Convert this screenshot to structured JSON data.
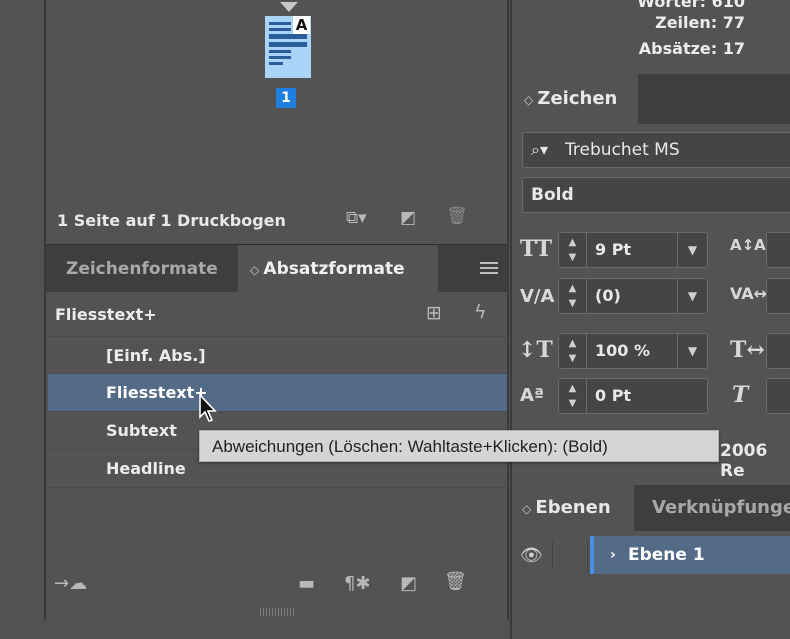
{
  "pages_panel": {
    "page_number": "1",
    "thumb_master": "A",
    "status": "1 Seite auf 1 Druckbogen"
  },
  "styles_panel": {
    "tabs": [
      "Zeichenformate",
      "Absatzformate"
    ],
    "active_tab_index": 1,
    "current_style": "Fliesstext+",
    "items": [
      "[Einf. Abs.]",
      "Fliesstext+",
      "Subtext",
      "Headline"
    ],
    "selected_index": 1,
    "tooltip": "Abweichungen (Löschen: Wahltaste+Klicken):  (Bold)"
  },
  "info_panel": {
    "words": "Wörter: 610",
    "lines": "Zeilen: 77",
    "paragraphs": "Absätze: 17"
  },
  "character_panel": {
    "tab_label": "Zeichen",
    "font_family": "Trebuchet MS",
    "font_style": "Bold",
    "font_size": "9 Pt",
    "kerning": "(0)",
    "vertical_scale": "100 %",
    "baseline_shift": "0 Pt",
    "language_partial": "2006 Re"
  },
  "layers_panel": {
    "tabs": [
      "Ebenen",
      "Verknüpfunge"
    ],
    "layer_name": "Ebene 1"
  },
  "colors": {
    "selection": "#546b87",
    "page_badge": "#1f7fe0",
    "layer_color": "#4a90e2"
  }
}
